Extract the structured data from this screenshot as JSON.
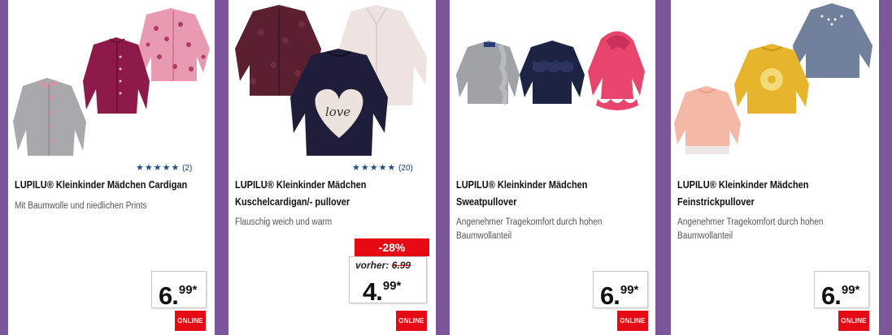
{
  "colors": {
    "background": "#7b569b",
    "brand_red": "#e60a14",
    "star_blue": "#1f4e8c"
  },
  "products": [
    {
      "name": "LUPILU® Kleinkinder Mädchen Cardigan",
      "description": "Mit Baumwolle und niedlichen Prints",
      "rating_stars": "★★★★★",
      "rating_count": "(2)",
      "price_int": "6.",
      "price_dec": "99*",
      "badge": "ONLINE",
      "image_icon": "cardigans-image"
    },
    {
      "name_line1": "LUPILU® Kleinkinder Mädchen",
      "name_line2": "Kuschelcardigan/- pullover",
      "description": "Flauschig weich und warm",
      "rating_stars": "★★★★★",
      "rating_count": "(20)",
      "discount": "-28%",
      "old_price_label": "vorher:",
      "old_price": "6.99",
      "price_int": "4.",
      "price_dec": "99*",
      "badge": "ONLINE",
      "image_icon": "fluffy-pullovers-image"
    },
    {
      "name_line1": "LUPILU® Kleinkinder Mädchen",
      "name_line2": "Sweatpullover",
      "description_line1": "Angenehmer Tragekomfort durch hohen",
      "description_line2": "Baumwollanteil",
      "price_int": "6.",
      "price_dec": "99*",
      "badge": "ONLINE",
      "image_icon": "sweatpullovers-image"
    },
    {
      "name_line1": "LUPILU® Kleinkinder Mädchen",
      "name_line2": "Feinstrickpullover",
      "description_line1": "Angenehmer Tragekomfort durch hohen",
      "description_line2": "Baumwollanteil",
      "price_int": "6.",
      "price_dec": "99*",
      "badge": "ONLINE",
      "image_icon": "knit-pullovers-image"
    }
  ]
}
